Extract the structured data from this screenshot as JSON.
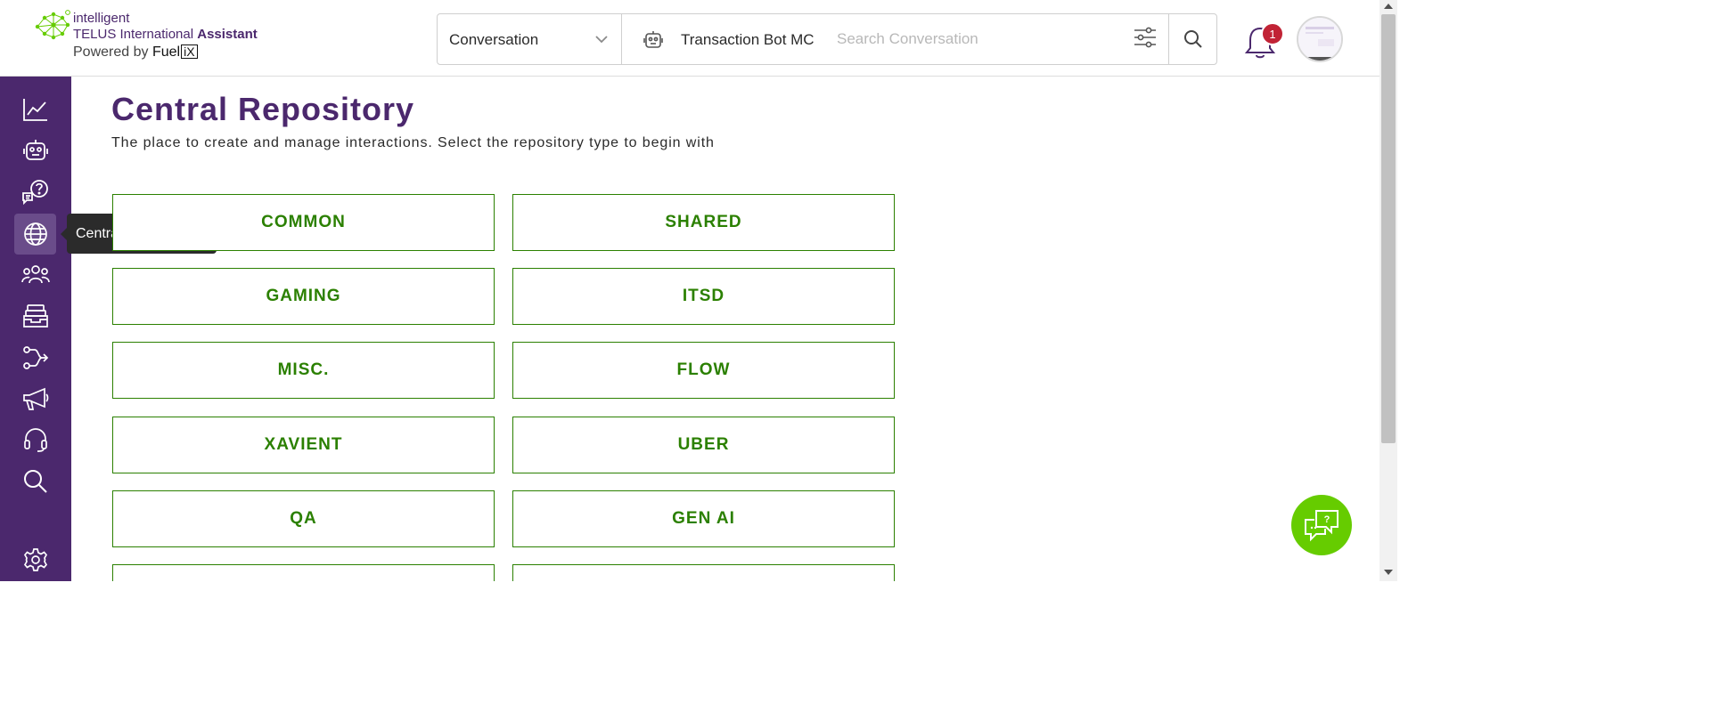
{
  "header": {
    "logo": {
      "line1": "intelligent",
      "line2_prefix": "TELUS International",
      "line2_bold": "Assistant",
      "line3_prefix": "Powered by",
      "line3_fuel": "Fuel",
      "line3_ix": "iX"
    },
    "search": {
      "type_selected": "Conversation",
      "bot_name": "Transaction Bot MC",
      "placeholder": "Search Conversation"
    },
    "notifications": {
      "count": "1"
    }
  },
  "sidebar": {
    "items": [
      {
        "name": "analytics",
        "icon": "line-chart-icon"
      },
      {
        "name": "bots",
        "icon": "robot-icon"
      },
      {
        "name": "faq",
        "icon": "question-chat-icon"
      },
      {
        "name": "central-repository",
        "icon": "globe-icon",
        "active": true
      },
      {
        "name": "users",
        "icon": "users-group-icon"
      },
      {
        "name": "inbox",
        "icon": "inbox-tray-icon"
      },
      {
        "name": "flows",
        "icon": "flow-branch-icon"
      },
      {
        "name": "campaigns",
        "icon": "megaphone-icon"
      },
      {
        "name": "support",
        "icon": "headset-icon"
      },
      {
        "name": "search",
        "icon": "search-icon"
      },
      {
        "name": "settings",
        "icon": "gear-icon"
      }
    ],
    "tooltip": "Central Repository"
  },
  "main": {
    "title": "Central Repository",
    "subtitle": "The place to create and manage interactions. Select the repository type to begin with",
    "repositories": [
      "COMMON",
      "SHARED",
      "GAMING",
      "ITSD",
      "MISC.",
      "FLOW",
      "XAVIENT",
      "UBER",
      "QA",
      "GEN AI",
      "",
      ""
    ]
  },
  "colors": {
    "brand_purple": "#4b286d",
    "accent_green": "#2b8000",
    "fab_green": "#66cc00",
    "badge_red": "#c12335"
  }
}
